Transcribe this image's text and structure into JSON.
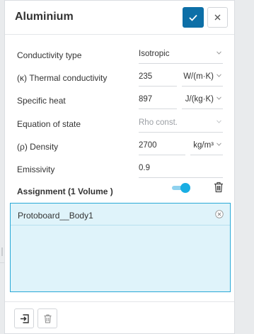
{
  "title": "Aluminium",
  "rows": {
    "conductivity_type": {
      "label": "Conductivity type",
      "value": "Isotropic"
    },
    "thermal_conductivity": {
      "label": "(κ) Thermal conductivity",
      "value": "235",
      "unit": "W/(m·K)"
    },
    "specific_heat": {
      "label": "Specific heat",
      "value": "897",
      "unit": "J/(kg·K)"
    },
    "equation_of_state": {
      "label": "Equation of state",
      "value": "Rho const."
    },
    "density": {
      "label": "(ρ) Density",
      "value": "2700",
      "unit": "kg/m³"
    },
    "emissivity": {
      "label": "Emissivity",
      "value": "0.9"
    }
  },
  "assignment": {
    "label": "Assignment (1 Volume )",
    "toggle_on": true,
    "items": [
      "Protoboard__Body1"
    ]
  },
  "colors": {
    "accent": "#0d6fa7",
    "selection_bg": "#dff3fa",
    "selection_border": "#2aa9d6",
    "toggle": "#19aee3"
  },
  "icons": [
    "check-icon",
    "close-icon",
    "chevron-down-icon",
    "trash-icon",
    "remove-circle-icon",
    "assign-in-icon"
  ]
}
